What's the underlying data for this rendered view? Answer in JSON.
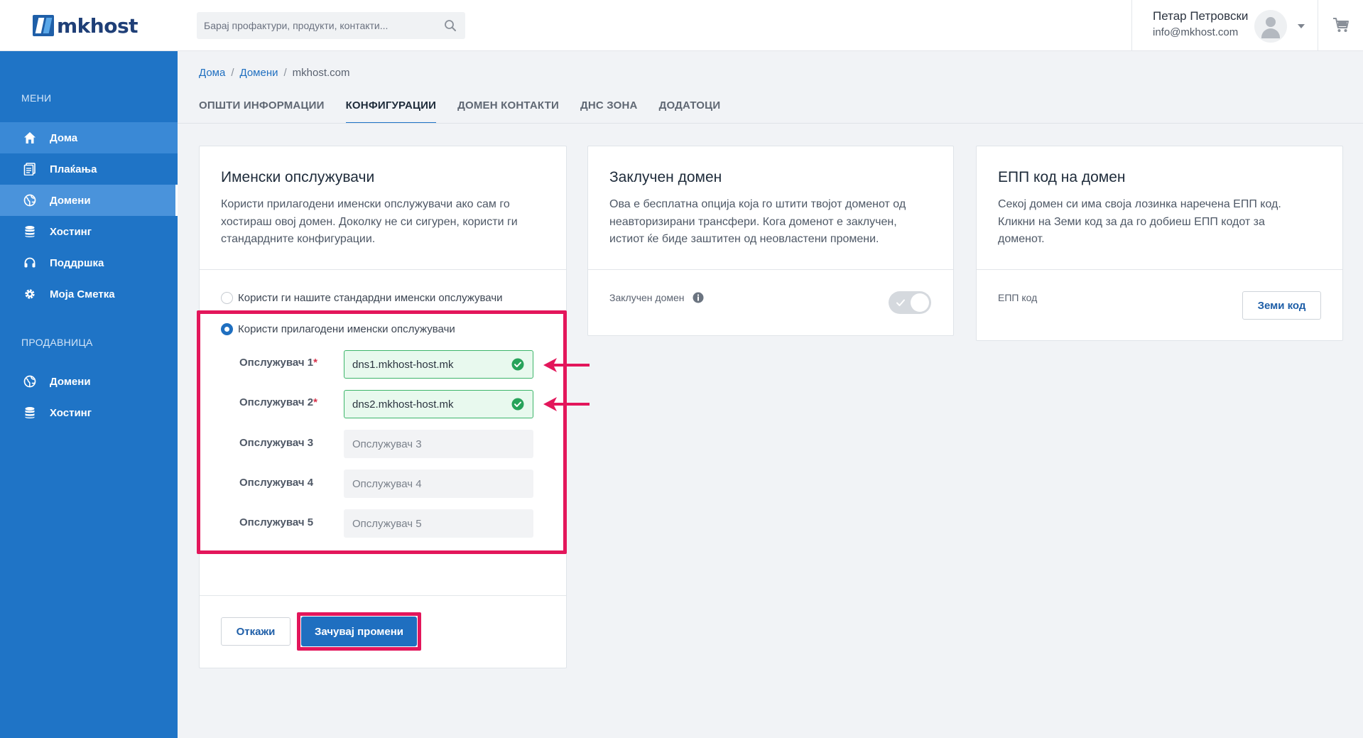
{
  "header": {
    "brand": "mkhost",
    "search_placeholder": "Барај профактури, продукти, контакти...",
    "user_name": "Петар Петровски",
    "user_email": "info@mkhost.com"
  },
  "sidebar": {
    "menu_heading": "МЕНИ",
    "menu_items": [
      {
        "label": "Дома",
        "icon": "home-icon"
      },
      {
        "label": "Плаќања",
        "icon": "invoice-icon"
      },
      {
        "label": "Домени",
        "icon": "globe-icon"
      },
      {
        "label": "Хостинг",
        "icon": "database-icon"
      },
      {
        "label": "Поддршка",
        "icon": "support-icon"
      },
      {
        "label": "Моја Сметка",
        "icon": "gear-icon"
      }
    ],
    "store_heading": "ПРОДАВНИЦА",
    "store_items": [
      {
        "label": "Домени",
        "icon": "globe-icon"
      },
      {
        "label": "Хостинг",
        "icon": "database-icon"
      }
    ]
  },
  "breadcrumb": [
    "Дома",
    "Домени",
    "mkhost.com"
  ],
  "tabs": [
    "ОПШТИ ИНФОРМАЦИИ",
    "КОНФИГУРАЦИИ",
    "ДОМЕН КОНТАКТИ",
    "ДНС ЗОНА",
    "ДОДАТОЦИ"
  ],
  "nameservers_card": {
    "title": "Именски опслужувачи",
    "desc": [
      "Користи прилагодени именски опслужувачи ако сам го",
      "хостираш овој домен. Доколку не си сигурен, користи ги",
      "стандардните конфигурации."
    ],
    "option_default": "Користи ги нашите стандардни именски опслужувачи",
    "option_custom": "Користи прилагодени именски опслужувачи",
    "fields": [
      {
        "label": "Опслужувач 1",
        "required": "*",
        "value": "dns1.mkhost-host.mk",
        "placeholder": ""
      },
      {
        "label": "Опслужувач 2",
        "required": "*",
        "value": "dns2.mkhost-host.mk",
        "placeholder": ""
      },
      {
        "label": "Опслужувач 3",
        "required": "",
        "value": "",
        "placeholder": "Опслужувач 3"
      },
      {
        "label": "Опслужувач 4",
        "required": "",
        "value": "",
        "placeholder": "Опслужувач 4"
      },
      {
        "label": "Опслужувач 5",
        "required": "",
        "value": "",
        "placeholder": "Опслужувач 5"
      }
    ],
    "cancel_label": "Откажи",
    "save_label": "Зачувај промени"
  },
  "lock_card": {
    "title": "Заклучен домен",
    "desc": [
      "Ова е бесплатна опција која го штити твојот доменот од",
      "неавторизирани трансфери. Кога доменот е заклучен,",
      "истиот ќе биде заштитен од неовластени промени."
    ],
    "toggle_label": "Заклучен домен",
    "toggle_on": true
  },
  "epp_card": {
    "title": "ЕПП код на домен",
    "desc": [
      "Секој домен си има своја лозинка наречена ЕПП код.",
      "Кликни на Земи код за да го добиеш ЕПП кодот за",
      "доменот."
    ],
    "field_label": "ЕПП код",
    "button_label": "Земи код"
  },
  "colors": {
    "sidebar": "#1f74c6",
    "primary": "#1f6fc0",
    "highlight": "#e3165b",
    "valid_bg": "#e8f9ee",
    "valid_border": "#3db56a"
  }
}
